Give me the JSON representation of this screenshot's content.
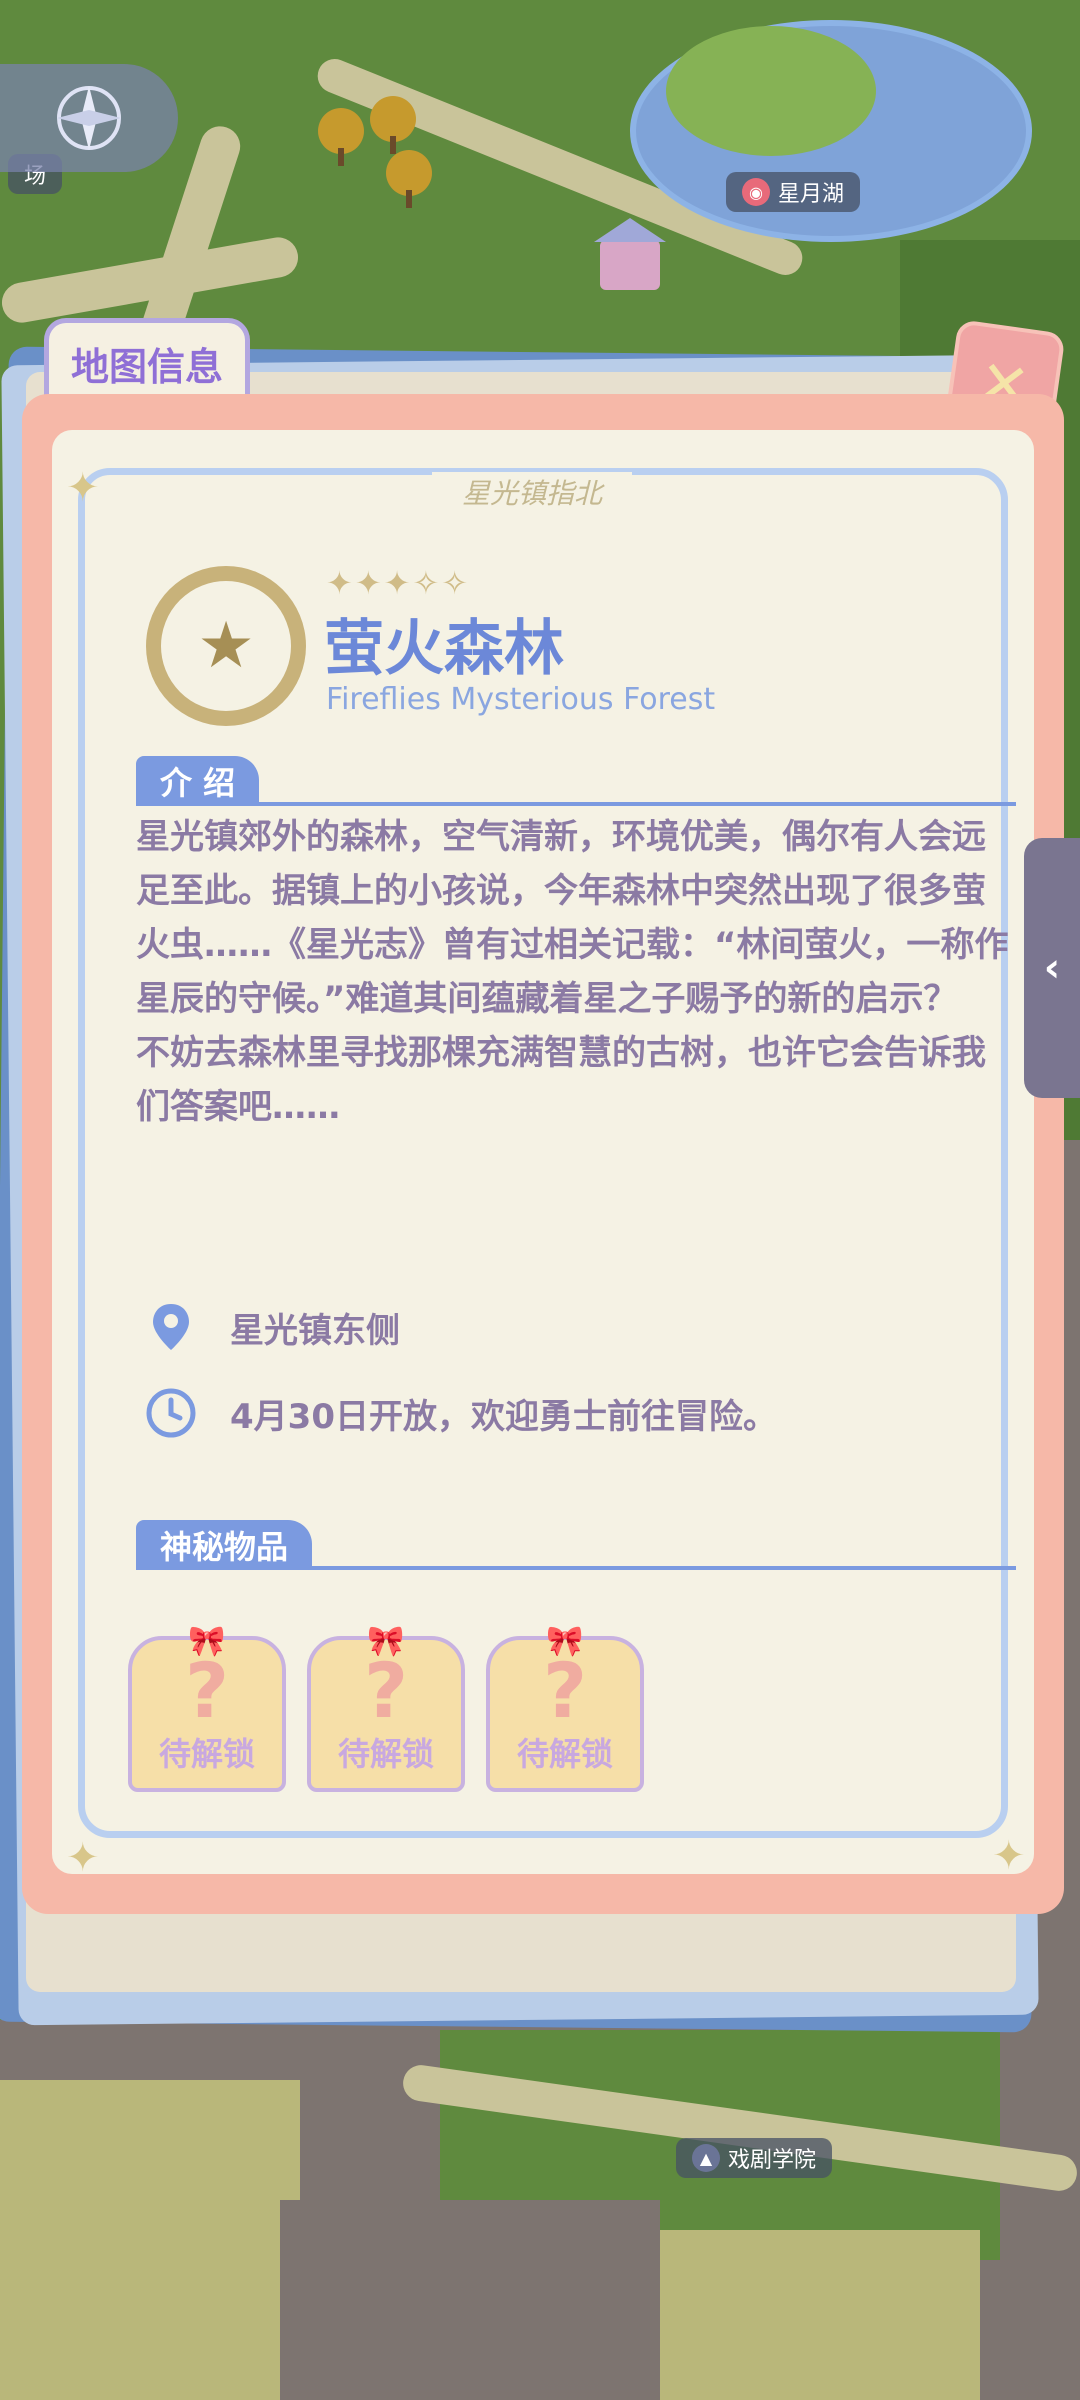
{
  "map": {
    "labels": {
      "plaza": "场",
      "lake": "星月湖",
      "school": "戏剧学院"
    }
  },
  "panel": {
    "tab_label": "地图信息",
    "close_label": "✕",
    "frame_title": "星光镇指北",
    "location": {
      "stars": "✦✦✦✧✧",
      "title": "萤火森林",
      "subtitle": "Fireflies Mysterious Forest"
    },
    "intro": {
      "heading": "介 绍",
      "paragraph1": "星光镇郊外的森林，空气清新，环境优美，偶尔有人会远足至此。据镇上的小孩说，今年森林中突然出现了很多萤火虫……《星光志》曾有过相关记载：“林间萤火，一称作星辰的守候。”难道其间蕴藏着星之子赐予的新的启示？",
      "paragraph2": "不妨去森林里寻找那棵充满智慧的古树，也许它会告诉我们答案吧……"
    },
    "place": "星光镇东侧",
    "open_time": "4月30日开放，欢迎勇士前往冒险。",
    "items": {
      "heading": "神秘物品",
      "slots": [
        {
          "symbol": "?",
          "label": "待解锁"
        },
        {
          "symbol": "?",
          "label": "待解锁"
        },
        {
          "symbol": "?",
          "label": "待解锁"
        }
      ]
    }
  },
  "side_handle": {
    "label": "‹"
  },
  "colors": {
    "accent_blue": "#7b9ae0",
    "title_purple": "#8f6fd6",
    "text_purple": "#8b7aa4",
    "card_pink": "#f6b8a8",
    "card_cream": "#f5f2e4"
  }
}
